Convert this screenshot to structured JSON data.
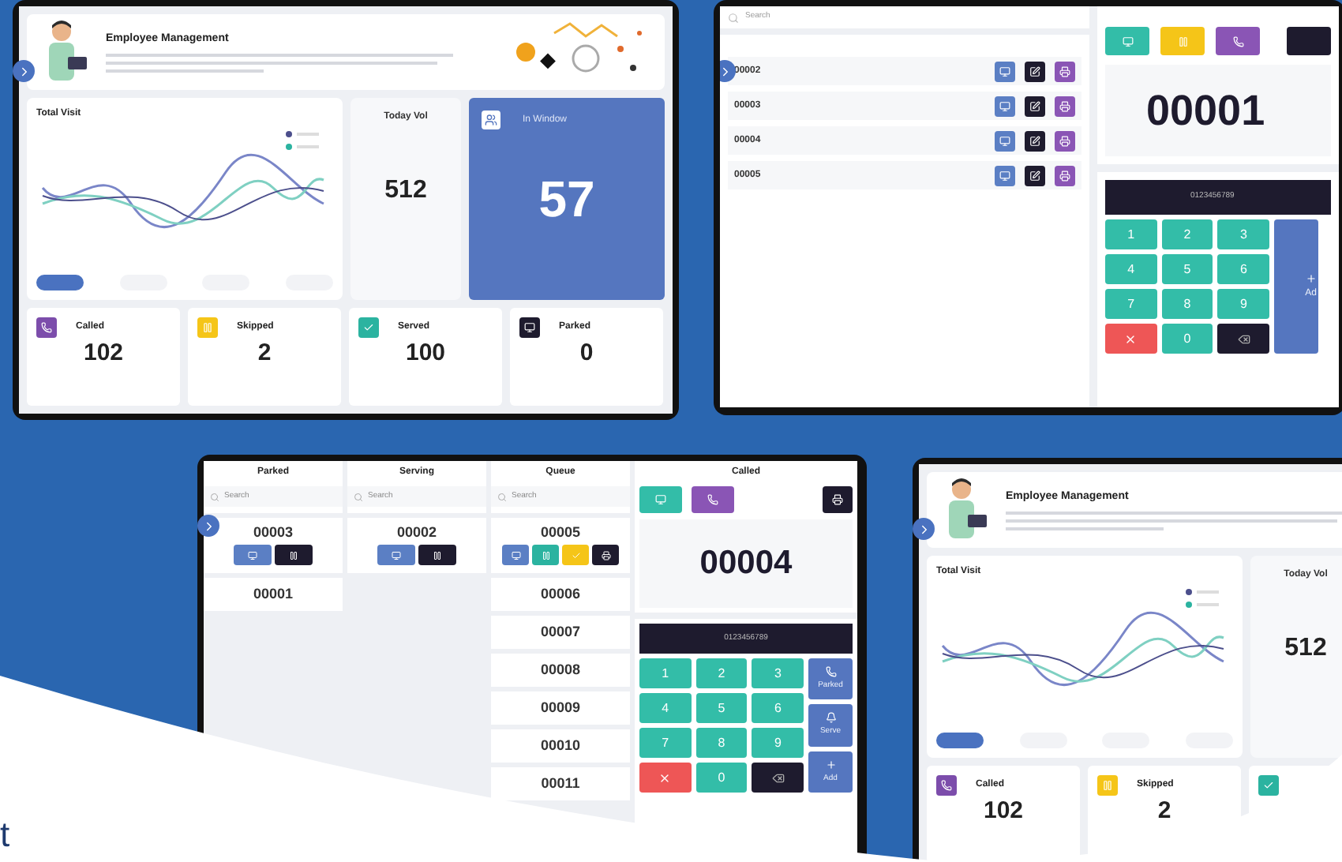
{
  "background_text": "t",
  "dashboards": [
    {
      "title": "Employee Management",
      "chart_title": "Total Visit",
      "today_label": "Today Vol",
      "today_value": "512",
      "window_label": "In Window",
      "window_value": "57",
      "stats": [
        {
          "label": "Called",
          "value": "102",
          "color": "#7c4dab"
        },
        {
          "label": "Skipped",
          "value": "2",
          "color": "#f5c518"
        },
        {
          "label": "Served",
          "value": "100",
          "color": "#2bb3a0"
        },
        {
          "label": "Parked",
          "value": "0",
          "color": "#1e1b2e"
        }
      ]
    },
    {
      "title": "Employee Management",
      "chart_title": "Total Visit",
      "today_label": "Today Vol",
      "today_value": "512",
      "stats": [
        {
          "label": "Called",
          "value": "102",
          "color": "#7c4dab"
        },
        {
          "label": "Skipped",
          "value": "2",
          "color": "#f5c518"
        },
        {
          "color": "#2bb3a0"
        }
      ]
    }
  ],
  "queue_screen": {
    "search_placeholder": "Search",
    "tickets": [
      "00002",
      "00003",
      "00004",
      "00005"
    ],
    "current_ticket": "00001",
    "phone": "0123456789",
    "keys": [
      {
        "kind": "digit",
        "label": "1"
      },
      {
        "kind": "digit",
        "label": "2"
      },
      {
        "kind": "digit",
        "label": "3"
      },
      {
        "kind": "digit",
        "label": "4"
      },
      {
        "kind": "digit",
        "label": "5"
      },
      {
        "kind": "digit",
        "label": "6"
      },
      {
        "kind": "digit",
        "label": "7"
      },
      {
        "kind": "digit",
        "label": "8"
      },
      {
        "kind": "digit",
        "label": "9"
      },
      {
        "kind": "clear"
      },
      {
        "kind": "digit",
        "label": "0"
      },
      {
        "kind": "backspace"
      }
    ],
    "side_key": "Ad"
  },
  "board_screen": {
    "columns": [
      {
        "title": "Parked",
        "search_placeholder": "Search",
        "tickets": [
          {
            "number": "00003",
            "actions": [
              {
                "color": "#5b7fc4"
              },
              {
                "color": "#1e1b2e"
              }
            ]
          },
          {
            "number": "00001"
          }
        ]
      },
      {
        "title": "Serving",
        "search_placeholder": "Search",
        "tickets": [
          {
            "number": "00002",
            "actions": [
              {
                "color": "#5b7fc4"
              },
              {
                "color": "#1e1b2e"
              }
            ]
          }
        ]
      },
      {
        "title": "Queue",
        "search_placeholder": "Search",
        "tickets": [
          {
            "number": "00005",
            "actions": [
              {
                "color": "#5b7fc4"
              },
              {
                "color": "#2bb3a0"
              },
              {
                "color": "#f5c518"
              },
              {
                "color": "#1e1b2e"
              }
            ]
          },
          {
            "number": "00006"
          },
          {
            "number": "00007"
          },
          {
            "number": "00008"
          },
          {
            "number": "00009"
          },
          {
            "number": "00010"
          },
          {
            "number": "00011"
          }
        ]
      }
    ],
    "called": {
      "title": "Called",
      "current_ticket": "00004",
      "phone": "0123456789",
      "keys": [
        {
          "kind": "digit",
          "label": "1"
        },
        {
          "kind": "digit",
          "label": "2"
        },
        {
          "kind": "digit",
          "label": "3"
        },
        {
          "kind": "digit",
          "label": "4"
        },
        {
          "kind": "digit",
          "label": "5"
        },
        {
          "kind": "digit",
          "label": "6"
        },
        {
          "kind": "digit",
          "label": "7"
        },
        {
          "kind": "digit",
          "label": "8"
        },
        {
          "kind": "digit",
          "label": "9"
        },
        {
          "kind": "clear"
        },
        {
          "kind": "digit",
          "label": "0"
        },
        {
          "kind": "backspace"
        }
      ],
      "side_keys": [
        {
          "kind": "park",
          "label": "Parked"
        },
        {
          "kind": "serve",
          "label": "Serve"
        },
        {
          "kind": "add",
          "label": "Add"
        }
      ]
    }
  }
}
